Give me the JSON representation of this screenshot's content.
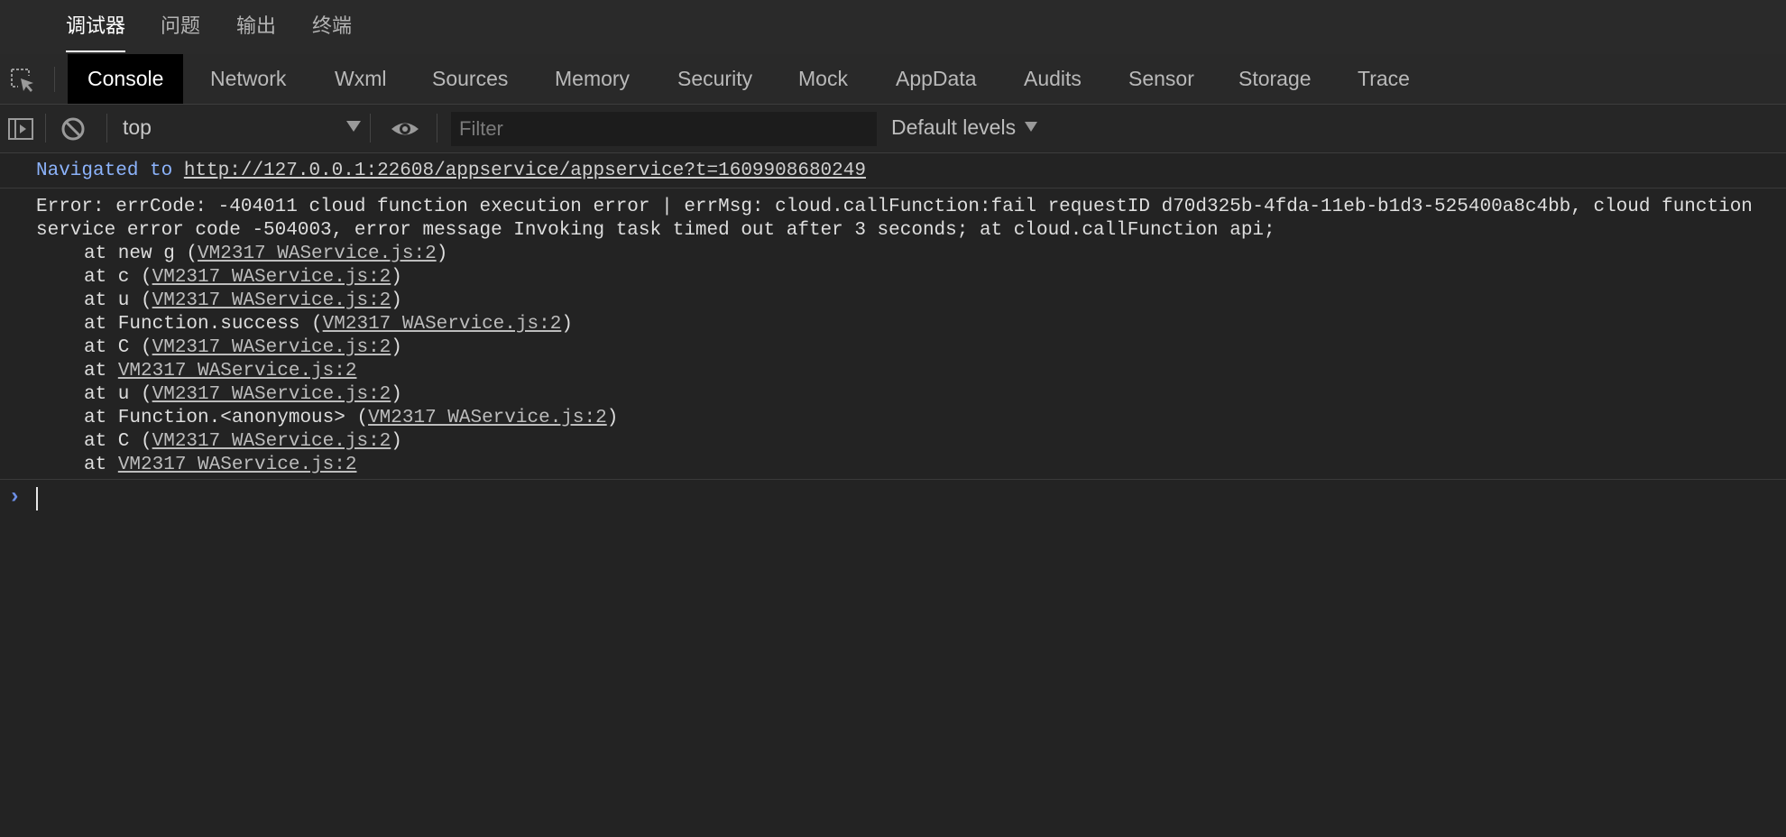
{
  "top_tabs": [
    {
      "label": "调试器",
      "active": true
    },
    {
      "label": "问题",
      "active": false
    },
    {
      "label": "输出",
      "active": false
    },
    {
      "label": "终端",
      "active": false
    }
  ],
  "panel_tabs": [
    {
      "label": "Console",
      "active": true
    },
    {
      "label": "Network"
    },
    {
      "label": "Wxml"
    },
    {
      "label": "Sources"
    },
    {
      "label": "Memory"
    },
    {
      "label": "Security"
    },
    {
      "label": "Mock"
    },
    {
      "label": "AppData"
    },
    {
      "label": "Audits"
    },
    {
      "label": "Sensor"
    },
    {
      "label": "Storage"
    },
    {
      "label": "Trace"
    }
  ],
  "toolbar": {
    "context": "top",
    "filter_placeholder": "Filter",
    "filter_value": "",
    "levels_label": "Default levels"
  },
  "console": {
    "navigated_prefix": "Navigated to ",
    "navigated_url": "http://127.0.0.1:22608/appservice/appservice?t=1609908680249",
    "error_text": "Error: errCode: -404011 cloud function execution error | errMsg: cloud.callFunction:fail requestID d70d325b-4fda-11eb-b1d3-525400a8c4bb, cloud function service error code -504003, error message Invoking task timed out after 3 seconds; at cloud.callFunction api;",
    "stack": [
      {
        "prefix": "at new g (",
        "link": "VM2317 WAService.js:2",
        "suffix": ")"
      },
      {
        "prefix": "at c (",
        "link": "VM2317 WAService.js:2",
        "suffix": ")"
      },
      {
        "prefix": "at u (",
        "link": "VM2317 WAService.js:2",
        "suffix": ")"
      },
      {
        "prefix": "at Function.success (",
        "link": "VM2317 WAService.js:2",
        "suffix": ")"
      },
      {
        "prefix": "at C (",
        "link": "VM2317 WAService.js:2",
        "suffix": ")"
      },
      {
        "prefix": "at ",
        "link": "VM2317 WAService.js:2",
        "suffix": ""
      },
      {
        "prefix": "at u (",
        "link": "VM2317 WAService.js:2",
        "suffix": ")"
      },
      {
        "prefix": "at Function.<anonymous> (",
        "link": "VM2317 WAService.js:2",
        "suffix": ")"
      },
      {
        "prefix": "at C (",
        "link": "VM2317 WAService.js:2",
        "suffix": ")"
      },
      {
        "prefix": "at ",
        "link": "VM2317 WAService.js:2",
        "suffix": ""
      }
    ],
    "prompt_symbol": "›"
  },
  "colors": {
    "background": "#232323",
    "active_tab_bg": "#000000",
    "navigated_blue": "#8cb3fb",
    "prompt_blue": "#6d8fe6"
  },
  "icons": {
    "inspect": "inspect-element-icon",
    "sidebar": "show-sidebar-icon",
    "clear": "clear-console-icon",
    "eye": "live-expression-eye-icon"
  }
}
